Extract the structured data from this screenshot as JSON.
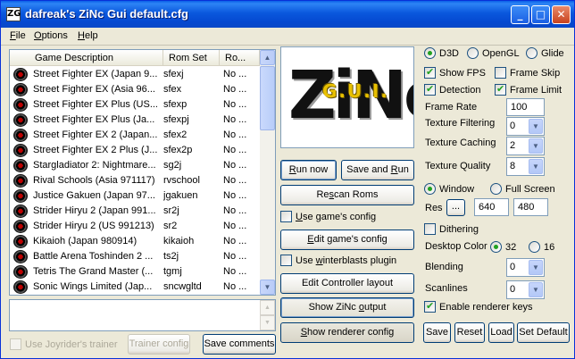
{
  "window": {
    "title": "dafreak's ZiNc Gui default.cfg",
    "icon_text": "ZG",
    "minimize_glyph": "_",
    "maximize_glyph": "□",
    "close_glyph": "✕"
  },
  "menu": [
    {
      "key": "F",
      "rest": "ile"
    },
    {
      "key": "O",
      "rest": "ptions"
    },
    {
      "key": "H",
      "rest": "elp"
    }
  ],
  "list": {
    "columns": [
      "Game Description",
      "Rom Set",
      "Ro..."
    ],
    "rows": [
      {
        "desc": "Street Fighter EX (Japan 9...",
        "set": "sfexj",
        "ro": "No ..."
      },
      {
        "desc": "Street Fighter EX (Asia 96...",
        "set": "sfex",
        "ro": "No ..."
      },
      {
        "desc": "Street Fighter EX Plus (US...",
        "set": "sfexp",
        "ro": "No ..."
      },
      {
        "desc": "Street Fighter EX Plus (Ja...",
        "set": "sfexpj",
        "ro": "No ..."
      },
      {
        "desc": "Street Fighter EX 2 (Japan...",
        "set": "sfex2",
        "ro": "No ..."
      },
      {
        "desc": "Street Fighter EX 2 Plus (J...",
        "set": "sfex2p",
        "ro": "No ..."
      },
      {
        "desc": "Stargladiator 2: Nightmare...",
        "set": "sg2j",
        "ro": "No ..."
      },
      {
        "desc": "Rival Schools (Asia 971117)",
        "set": "rvschool",
        "ro": "No ..."
      },
      {
        "desc": "Justice Gakuen (Japan 97...",
        "set": "jgakuen",
        "ro": "No ..."
      },
      {
        "desc": "Strider Hiryu 2 (Japan 991...",
        "set": "sr2j",
        "ro": "No ..."
      },
      {
        "desc": "Strider Hiryu 2 (US 991213)",
        "set": "sr2",
        "ro": "No ..."
      },
      {
        "desc": "Kikaioh (Japan 980914)",
        "set": "kikaioh",
        "ro": "No ..."
      },
      {
        "desc": "Battle Arena Toshinden 2 ...",
        "set": "ts2j",
        "ro": "No ..."
      },
      {
        "desc": "Tetris The Grand Master (...",
        "set": "tgmj",
        "ro": "No ..."
      },
      {
        "desc": "Sonic Wings Limited (Jap...",
        "set": "sncwgltd",
        "ro": "No ..."
      }
    ],
    "scroll_up": "▲",
    "scroll_down": "▼"
  },
  "bottom_left": {
    "joyrider_label": "Use Joyrider's trainer",
    "trainer_config": "Trainer config",
    "save_comments": "Save comments"
  },
  "logo": {
    "main": "ZiNc",
    "sub": "G.U.I."
  },
  "middle": {
    "run_now": {
      "a": "R",
      "b": "un now"
    },
    "save_and_run": {
      "a": "Save and ",
      "b": "R",
      "c": "un"
    },
    "rescan_roms": {
      "a": "Re",
      "b": "s",
      "c": "can Roms"
    },
    "use_games_config": {
      "a": "U",
      "b": "se game's config"
    },
    "edit_games_config": {
      "a": "E",
      "b": "dit game's config"
    },
    "use_winterblasts": {
      "a": "Use ",
      "b": "w",
      "c": "interblasts plugin"
    },
    "edit_controller": "Edit Controller layout",
    "show_zinc_output": {
      "a": "Show ZiNc ",
      "b": "o",
      "c": "utput"
    },
    "show_renderer_config": {
      "a": "S",
      "b": "how renderer config"
    }
  },
  "right": {
    "renderers": [
      {
        "label": "D3D",
        "u": "D"
      },
      {
        "label": "OpenGL",
        "u": "O"
      },
      {
        "label": "Glide",
        "u": "G"
      }
    ],
    "selected_renderer": "D3D",
    "show_fps": "Show FPS",
    "frame_skip": "Frame Skip",
    "detection": "Detection",
    "frame_limit": "Frame Limit",
    "frame_rate_label": "Frame Rate",
    "frame_rate_value": "100",
    "texture_filtering_label": "Texture Filtering",
    "texture_filtering_value": "0",
    "texture_caching_label": "Texture Caching",
    "texture_caching_value": "2",
    "texture_quality_label": "Texture Quality",
    "texture_quality_value": "8",
    "window_label": "Window",
    "full_screen_label": "Full Screen",
    "res_label": "Res",
    "res_button": "...",
    "res_w": "640",
    "res_h": "480",
    "dithering": "Dithering",
    "desktop_color_label": "Desktop Color",
    "color_32": "32",
    "color_16": "16",
    "blending_label": "Blending",
    "blending_value": "0",
    "scanlines_label": "Scanlines",
    "scanlines_value": "0",
    "enable_renderer_keys": "Enable renderer keys",
    "save": "Save",
    "reset": "Reset",
    "load": "Load",
    "set_default": "Set Default"
  },
  "colors": {
    "titlebar": "#0A58DD",
    "dialog": "#ECE9D8",
    "border": "#7F9DB9",
    "check": "#21A121"
  },
  "icons": {
    "row_icon": "game-disc-icon",
    "dropdown": "chevron-down-icon"
  }
}
